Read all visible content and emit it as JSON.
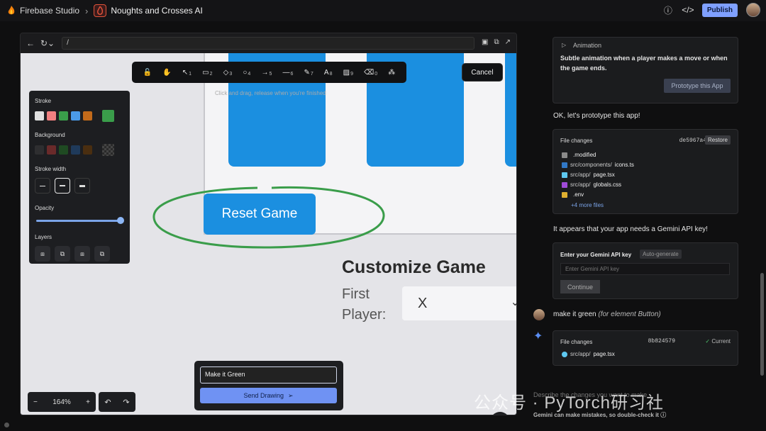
{
  "app": {
    "name": "Firebase Studio",
    "project": "Noughts and Crosses AI",
    "publish_label": "Publish"
  },
  "browser": {
    "url": "/"
  },
  "canvas": {
    "hint": "Click and drag, release when you're finished",
    "reset_label": "Reset Game",
    "customize_title": "Customize Game",
    "first_player_label_1": "First",
    "first_player_label_2": "Player:",
    "first_player_value": "X"
  },
  "toolbar": {
    "tools": [
      {
        "icon": "lock-icon",
        "glyph": "🔓",
        "key": ""
      },
      {
        "icon": "hand-icon",
        "glyph": "✋",
        "key": ""
      },
      {
        "icon": "select-icon",
        "glyph": "↖",
        "key": "1"
      },
      {
        "icon": "rectangle-icon",
        "glyph": "▭",
        "key": "2"
      },
      {
        "icon": "diamond-icon",
        "glyph": "◇",
        "key": "3"
      },
      {
        "icon": "ellipse-icon",
        "glyph": "○",
        "key": "4"
      },
      {
        "icon": "arrow-icon",
        "glyph": "→",
        "key": "5"
      },
      {
        "icon": "line-icon",
        "glyph": "—",
        "key": "6"
      },
      {
        "icon": "pencil-icon",
        "glyph": "✎",
        "key": "7"
      },
      {
        "icon": "text-icon",
        "glyph": "A",
        "key": "8"
      },
      {
        "icon": "image-icon",
        "glyph": "▨",
        "key": "9"
      },
      {
        "icon": "eraser-icon",
        "glyph": "⌫",
        "key": "0"
      },
      {
        "icon": "shapes-icon",
        "glyph": "⁂",
        "key": ""
      }
    ],
    "cancel_label": "Cancel"
  },
  "style_panel": {
    "stroke_label": "Stroke",
    "stroke_colors": [
      "#e0e0e0",
      "#f08080",
      "#3a9d4a",
      "#4b9ae8",
      "#c26a1a"
    ],
    "stroke_selected": "#3a9d4a",
    "background_label": "Background",
    "background_colors": [
      "#2e2e30",
      "#6a2a2a",
      "#1f4a22",
      "#1f3a5a",
      "#4a2e10"
    ],
    "stroke_width_label": "Stroke width",
    "opacity_label": "Opacity",
    "opacity_value": 1.0,
    "layers_label": "Layers"
  },
  "zoom": {
    "minus": "−",
    "value": "164%",
    "plus": "+"
  },
  "drawing": {
    "input_value": "Make it Green",
    "send_label": "Send Drawing"
  },
  "chat": {
    "animation_title": "Animation",
    "animation_desc": "Subtle animation when a player makes a move or when the game ends.",
    "prototype_label": "Prototype this App",
    "ok_message": "OK, let's prototype this app!",
    "file_changes_1": {
      "title": "File changes",
      "hash": "de5967a4",
      "restore_label": "Restore",
      "files": [
        {
          "dir": "",
          "name": ".modified",
          "color": "#8a8a8a"
        },
        {
          "dir": "src/components/",
          "name": "icons.ts",
          "color": "#3178c6"
        },
        {
          "dir": "src/app/",
          "name": "page.tsx",
          "color": "#5ec8f0"
        },
        {
          "dir": "src/app/",
          "name": "globals.css",
          "color": "#a04bd8"
        },
        {
          "dir": "",
          "name": ".env",
          "color": "#e0b030"
        }
      ],
      "more": "+4 more files"
    },
    "api_message": "It appears that your app needs a Gemini API key!",
    "api_title": "Enter your Gemini API key",
    "auto_generate": "Auto-generate",
    "api_placeholder": "Enter Gemini API key",
    "continue_label": "Continue",
    "user_message": "make it green",
    "user_context": "(for element Button)",
    "file_changes_2": {
      "title": "File changes",
      "hash": "8b824579",
      "status": "Current",
      "file_dir": "src/app/",
      "file_name": "page.tsx"
    },
    "input_placeholder": "Describe the changes you want to make",
    "disclaimer": "Gemini can make mistakes, so double-check it"
  },
  "watermark": "公众号 · PyTorch研习社"
}
